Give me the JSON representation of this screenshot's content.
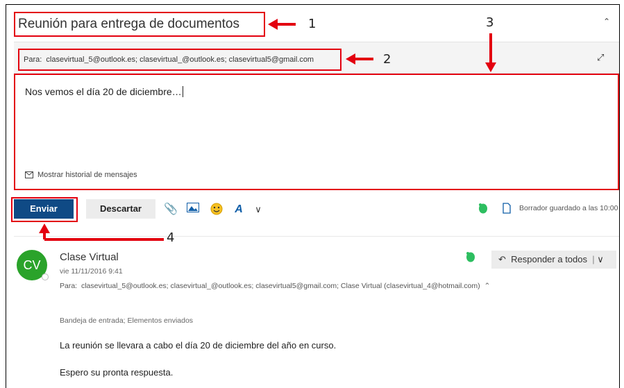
{
  "compose": {
    "subject": "Reunión para entrega de documentos",
    "to_label": "Para:",
    "to_recipients": "clasevirtual_5@outlook.es; clasevirtual_@outlook.es; clasevirtual5@gmail.com",
    "body": "Nos vemos el día 20 de diciembre…",
    "show_history": "Mostrar historial de mensajes",
    "send_label": "Enviar",
    "discard_label": "Descartar",
    "draft_status": "Borrador guardado a las 10:00"
  },
  "callouts": {
    "one": "1",
    "two": "2",
    "three": "3",
    "four": "4"
  },
  "message": {
    "avatar_initials": "CV",
    "sender": "Clase Virtual",
    "date": "vie 11/11/2016 9:41",
    "to_label": "Para:",
    "to_recipients": "clasevirtual_5@outlook.es; clasevirtual_@outlook.es; clasevirtual5@gmail.com; Clase Virtual (clasevirtual_4@hotmail.com)",
    "reply_all_label": "Responder a todos",
    "folders": "Bandeja de entrada; Elementos enviados",
    "line1": "La reunión se llevara a cabo el día 20 de diciembre del año en curso.",
    "line2": "Espero su pronta respuesta."
  },
  "icons": {
    "collapse": "chevron-double-up-icon",
    "expand": "expand-arrows-icon",
    "history": "envelope-icon",
    "attach": "paperclip-icon",
    "image": "image-icon",
    "emoji": "smiley-icon",
    "format": "text-format-icon",
    "more": "chevron-down-icon",
    "evernote": "evernote-icon",
    "draft": "document-icon",
    "reply": "reply-all-icon"
  },
  "colors": {
    "annotation_red": "#e3000f",
    "send_button": "#0f4a85",
    "avatar": "#2aa32a",
    "evernote": "#2dbe60"
  }
}
